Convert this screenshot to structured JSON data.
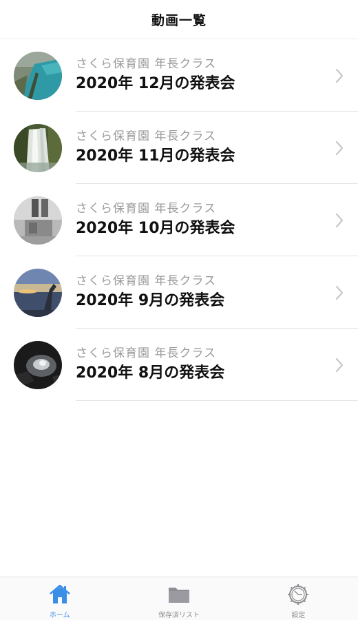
{
  "header": {
    "title": "動画一覧"
  },
  "videos": [
    {
      "subtitle": "さくら保育園 年長クラス",
      "title": "2020年 12月の発表会",
      "thumbnail": "landscape-lake"
    },
    {
      "subtitle": "さくら保育園 年長クラス",
      "title": "2020年 11月の発表会",
      "thumbnail": "waterfall"
    },
    {
      "subtitle": "さくら保育園 年長クラス",
      "title": "2020年 10月の発表会",
      "thumbnail": "building"
    },
    {
      "subtitle": "さくら保育園 年長クラス",
      "title": "2020年 9月の発表会",
      "thumbnail": "sunset-beach"
    },
    {
      "subtitle": "さくら保育園 年長クラス",
      "title": "2020年 8月の発表会",
      "thumbnail": "cave-water"
    }
  ],
  "tabs": [
    {
      "label": "ホーム",
      "icon": "home-icon",
      "active": true
    },
    {
      "label": "保存済リスト",
      "icon": "folder-icon",
      "active": false
    },
    {
      "label": "設定",
      "icon": "gear-icon",
      "active": false
    }
  ],
  "colors": {
    "accent": "#3a8ee6",
    "inactive": "#8e8e93"
  }
}
